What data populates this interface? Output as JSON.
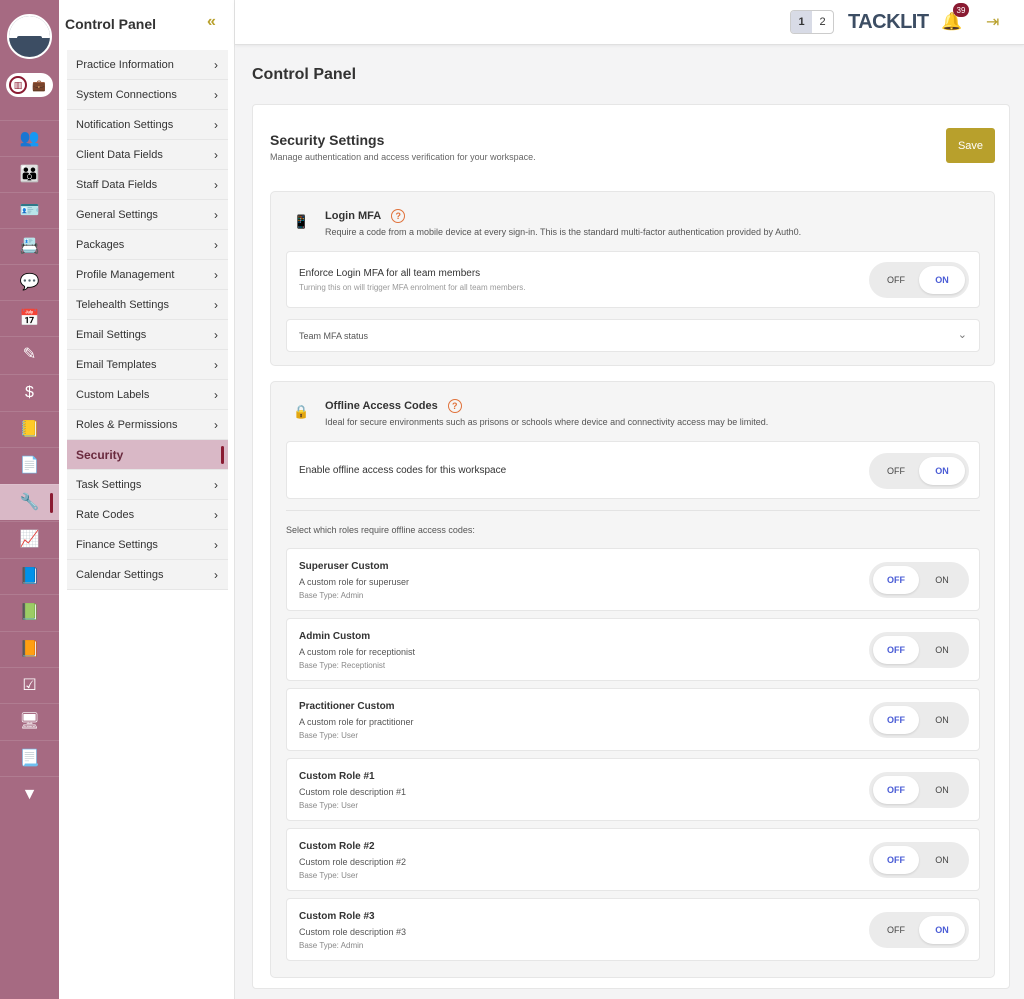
{
  "rail": {
    "items": [
      {
        "icon": "users-icon",
        "glyph": "👥"
      },
      {
        "icon": "group-icon",
        "glyph": "👪"
      },
      {
        "icon": "id-card-icon",
        "glyph": "🪪"
      },
      {
        "icon": "contact-icon",
        "glyph": "📇"
      },
      {
        "icon": "chat-icon",
        "glyph": "💬"
      },
      {
        "icon": "calendar-icon",
        "glyph": "📅"
      },
      {
        "icon": "pencil-icon",
        "glyph": "✎"
      },
      {
        "icon": "dollar-icon",
        "glyph": "$"
      },
      {
        "icon": "address-book-icon",
        "glyph": "📒"
      },
      {
        "icon": "document-icon",
        "glyph": "📄"
      },
      {
        "icon": "wrench-icon",
        "glyph": "🔧"
      },
      {
        "icon": "chart-icon",
        "glyph": "📈"
      },
      {
        "icon": "book-icon",
        "glyph": "📘"
      },
      {
        "icon": "book-icon",
        "glyph": "📗"
      },
      {
        "icon": "book-icon",
        "glyph": "📙"
      },
      {
        "icon": "checklist-icon",
        "glyph": "☑"
      },
      {
        "icon": "monitor-icon",
        "glyph": "🖥"
      },
      {
        "icon": "file-icon",
        "glyph": "📃"
      },
      {
        "icon": "vic-logo-icon",
        "glyph": "▼"
      }
    ]
  },
  "subnav": {
    "title": "Control Panel",
    "collapse_glyph": "«",
    "items": [
      "Practice Information",
      "System Connections",
      "Notification Settings",
      "Client Data Fields",
      "Staff Data Fields",
      "General Settings",
      "Packages",
      "Profile Management",
      "Telehealth Settings",
      "Email Settings",
      "Email Templates",
      "Custom Labels",
      "Roles & Permissions",
      "Security",
      "Task Settings",
      "Rate Codes",
      "Finance Settings",
      "Calendar Settings"
    ],
    "active_index": 13
  },
  "header": {
    "pages": [
      "1",
      "2"
    ],
    "brand": "TACKLIT",
    "notification_count": "39"
  },
  "page": {
    "title": "Control Panel"
  },
  "security": {
    "title": "Security Settings",
    "subtitle": "Manage authentication and access verification for your workspace.",
    "save_label": "Save",
    "login_mfa": {
      "title": "Login MFA",
      "description": "Require a code from a mobile device at every sign-in. This is the standard multi-factor authentication provided by Auth0.",
      "enforce_title": "Enforce Login MFA for all team members",
      "enforce_hint": "Turning this on will trigger MFA enrolment for all team members.",
      "enforce_state": "on",
      "team_status_label": "Team MFA status"
    },
    "offline": {
      "title": "Offline Access Codes",
      "description": "Ideal for secure environments such as prisons or schools where device and connectivity access may be limited.",
      "enable_title": "Enable offline access codes for this workspace",
      "enable_state": "on",
      "roles_label": "Select which roles require offline access codes:",
      "roles": [
        {
          "name": "Superuser Custom",
          "description": "A custom role for superuser",
          "base": "Base Type: Admin",
          "state": "off"
        },
        {
          "name": "Admin Custom",
          "description": "A custom role for receptionist",
          "base": "Base Type: Receptionist",
          "state": "off"
        },
        {
          "name": "Practitioner Custom",
          "description": "A custom role for practitioner",
          "base": "Base Type: User",
          "state": "off"
        },
        {
          "name": "Custom Role #1",
          "description": "Custom role description #1",
          "base": "Base Type: User",
          "state": "off"
        },
        {
          "name": "Custom Role #2",
          "description": "Custom role description #2",
          "base": "Base Type: User",
          "state": "off"
        },
        {
          "name": "Custom Role #3",
          "description": "Custom role description #3",
          "base": "Base Type: Admin",
          "state": "on"
        }
      ]
    },
    "toggle_labels": {
      "off": "OFF",
      "on": "ON"
    }
  },
  "colors": {
    "rail": "#a66a82",
    "accent_gold": "#b8a02c",
    "active_blue": "#4a5cd6",
    "help_orange": "#e0723b",
    "brand_navy": "#3c4d63"
  }
}
